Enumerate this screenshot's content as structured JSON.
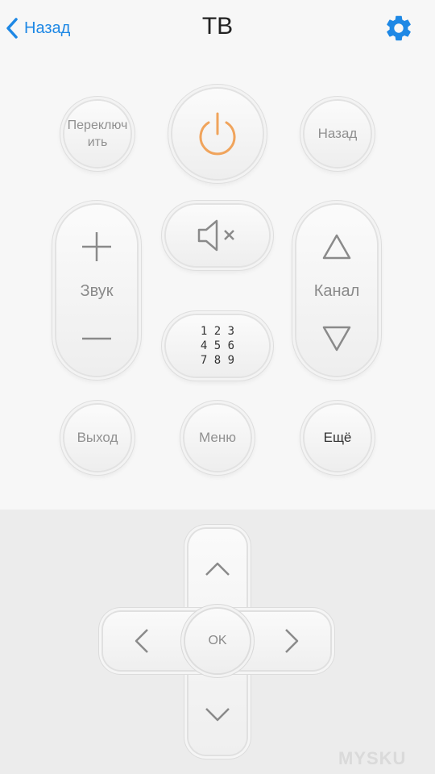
{
  "header": {
    "back_label": "Назад",
    "title": "ТВ",
    "settings_icon": "gear-icon"
  },
  "remote": {
    "switch_label_line1": "Переключ",
    "switch_label_line2": "ить",
    "power_icon": "power-icon",
    "back_label": "Назад",
    "volume_label": "Звук",
    "mute_icon": "mute-icon",
    "channel_label": "Канал",
    "numpad_row1": "1 2 3",
    "numpad_row2": "4 5 6",
    "numpad_row3": "7 8 9",
    "exit_label": "Выход",
    "menu_label": "Меню",
    "more_label": "Ещё"
  },
  "dpad": {
    "ok_label": "OK"
  },
  "watermark": "MYSKU",
  "colors": {
    "accent": "#1e88e5",
    "power": "#f0a45c",
    "background": "#f7f7f7",
    "dpad_background": "#ececec"
  }
}
